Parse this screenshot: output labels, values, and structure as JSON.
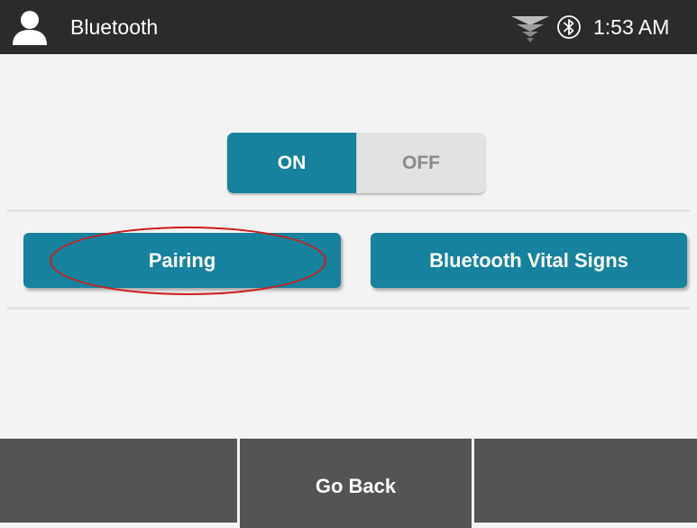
{
  "header": {
    "title": "Bluetooth",
    "time": "1:53 AM",
    "icons": [
      "user-icon",
      "signal-icon",
      "bluetooth-icon"
    ]
  },
  "toggle": {
    "on_label": "ON",
    "off_label": "OFF",
    "selected": "ON"
  },
  "actions": {
    "pairing_label": "Pairing",
    "vitals_label": "Bluetooth Vital Signs"
  },
  "footer": {
    "left_label": "",
    "back_label": "Go Back",
    "right_label": ""
  },
  "colors": {
    "accent": "#16829d",
    "header_bg": "#2b2b2b",
    "footer_bg": "#545454",
    "annotation": "#d11a1a"
  }
}
